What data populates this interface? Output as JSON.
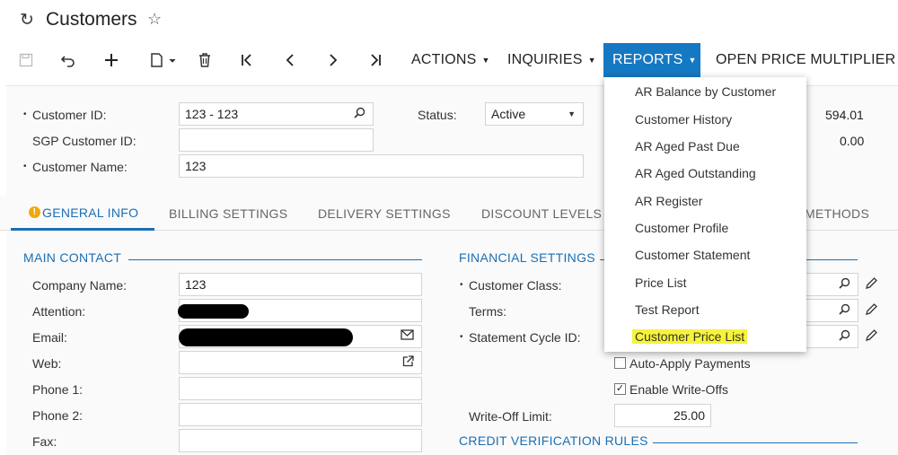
{
  "header": {
    "title": "Customers",
    "refresh_icon": "↻",
    "star_icon": "☆"
  },
  "toolbar": {
    "actions": "ACTIONS",
    "inquiries": "INQUIRIES",
    "reports": "REPORTS",
    "open_price_multiplier": "OPEN PRICE MULTIPLIER"
  },
  "summary": {
    "customer_id_label": "Customer ID:",
    "customer_id_value": "123 - 123",
    "sgp_label": "SGP Customer ID:",
    "sgp_value": "",
    "customer_name_label": "Customer Name:",
    "customer_name_value": "123",
    "status_label": "Status:",
    "status_value": "Active",
    "balance_value": "594.01",
    "second_value": "0.00"
  },
  "tabs": [
    {
      "label": "GENERAL INFO"
    },
    {
      "label": "BILLING SETTINGS"
    },
    {
      "label": "DELIVERY SETTINGS"
    },
    {
      "label": "DISCOUNT LEVELS"
    },
    {
      "label": "METHODS"
    }
  ],
  "main_contact": {
    "title": "MAIN CONTACT",
    "company_name_label": "Company Name:",
    "company_name_value": "123",
    "attention_label": "Attention:",
    "email_label": "Email:",
    "web_label": "Web:",
    "phone1_label": "Phone 1:",
    "phone2_label": "Phone 2:",
    "fax_label": "Fax:"
  },
  "financial": {
    "title": "FINANCIAL SETTINGS",
    "customer_class_label": "Customer Class:",
    "terms_label": "Terms:",
    "statement_cycle_label": "Statement Cycle ID:",
    "auto_apply_label": "Auto-Apply Payments",
    "auto_apply_checked": false,
    "enable_writeoffs_label": "Enable Write-Offs",
    "enable_writeoffs_checked": true,
    "writeoff_limit_label": "Write-Off Limit:",
    "writeoff_limit_value": "25.00"
  },
  "credit": {
    "title": "CREDIT VERIFICATION RULES"
  },
  "reports_menu": [
    "AR Balance by Customer",
    "Customer History",
    "AR Aged Past Due",
    "AR Aged Outstanding",
    "AR Register",
    "Customer Profile",
    "Customer Statement",
    "Price List",
    "Test Report",
    "Customer Price List"
  ],
  "colors": {
    "accent": "#1a6fb5",
    "active_menu": "#1578c2",
    "highlight": "#f6f33a",
    "warning": "#f0a90b"
  }
}
